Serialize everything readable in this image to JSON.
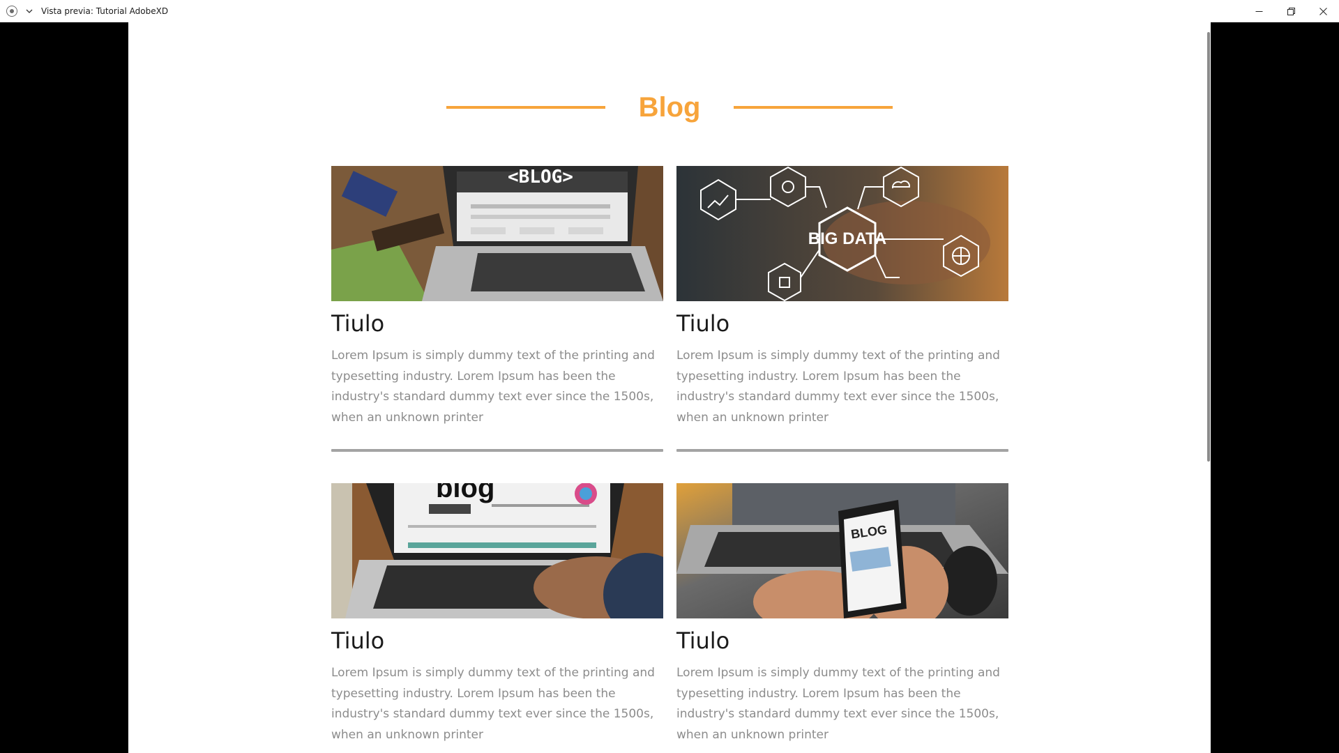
{
  "window": {
    "title": "Vista previa: Tutorial AdobeXD"
  },
  "page": {
    "heading": "Blog",
    "accent_color": "#f7a43b"
  },
  "cards": [
    {
      "title": "Tiulo",
      "body": "Lorem Ipsum is simply dummy text of the printing and typesetting industry. Lorem Ipsum has been the industry's standard dummy text ever since the 1500s, when an unknown printer",
      "image_text": "<BLOG>"
    },
    {
      "title": "Tiulo",
      "body": "Lorem Ipsum is simply dummy text of the printing and typesetting industry. Lorem Ipsum has been the industry's standard dummy text ever since the 1500s, when an unknown printer",
      "image_text": "BIG DATA"
    },
    {
      "title": "Tiulo",
      "body": "Lorem Ipsum is simply dummy text of the printing and typesetting industry. Lorem Ipsum has been the industry's standard dummy text ever since the 1500s, when an unknown printer",
      "image_text": "blog"
    },
    {
      "title": "Tiulo",
      "body": "Lorem Ipsum is simply dummy text of the printing and typesetting industry. Lorem Ipsum has been the industry's standard dummy text ever since the 1500s, when an unknown printer",
      "image_text": "BLOG"
    }
  ]
}
